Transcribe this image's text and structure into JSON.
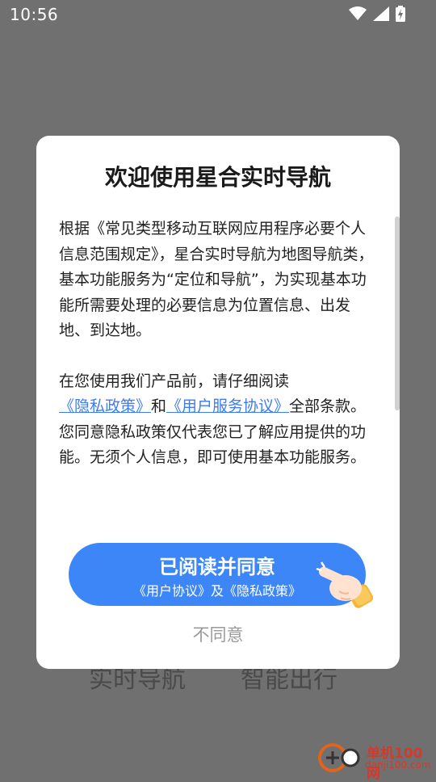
{
  "status_bar": {
    "time": "10:56",
    "icons": [
      "wifi-icon",
      "signal-icon",
      "battery-charging-icon"
    ]
  },
  "background_app": {
    "labels": [
      "实时导航",
      "智能出行"
    ]
  },
  "dialog": {
    "title": "欢迎使用星合实时导航",
    "paragraph1": "根据《常见类型移动互联网应用程序必要个人信息范围规定》，星合实时导航为地图导航类，基本功能服务为“定位和导航”，为实现基本功能所需要处理的必要信息为位置信息、出发地、到达地。",
    "paragraph2_intro": "在您使用我们产品前，请仔细阅读",
    "privacy_link": "《隐私政策》",
    "and_text": "和",
    "user_agreement_link": "《用户服务协议》",
    "paragraph2_rest": "全部条款。您同意隐私政策仅代表您已了解应用提供的功能。无须个人信息，即可使用基本功能服务。",
    "agree_button": {
      "main": "已阅读并同意",
      "sub": "《用户协议》及《隐私政策》"
    },
    "disagree_label": "不同意"
  },
  "watermark": {
    "name": "单机100网",
    "url": "danji100.com"
  },
  "colors": {
    "accent": "#3d86f7",
    "link": "#3d7bf7",
    "overlay": "#707070",
    "watermark": "#d33a2c"
  }
}
